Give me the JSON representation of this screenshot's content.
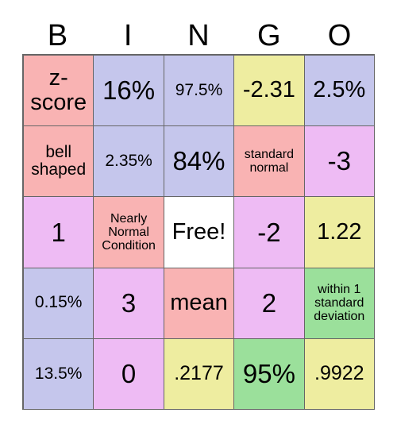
{
  "card": {
    "title": "BINGO",
    "headers": [
      "B",
      "I",
      "N",
      "G",
      "O"
    ],
    "colors": {
      "salmon": "#f9b3b3",
      "lavender": "#c5c6ec",
      "yellow": "#eeeda0",
      "violet": "#eebbf4",
      "green": "#9be09b",
      "white": "#ffffff",
      "grid_line": "#666666",
      "text": "#000000"
    },
    "rows": [
      [
        {
          "text": "z-score",
          "color": "#f9b3b3",
          "size": "fs-lg"
        },
        {
          "text": "16%",
          "color": "#c5c6ec",
          "size": "fs-xl"
        },
        {
          "text": "97.5%",
          "color": "#c5c6ec",
          "size": "fs-sm"
        },
        {
          "text": "-2.31",
          "color": "#eeeda0",
          "size": "fs-lg"
        },
        {
          "text": "2.5%",
          "color": "#c5c6ec",
          "size": "fs-lg"
        }
      ],
      [
        {
          "text": "bell shaped",
          "color": "#f9b3b3",
          "size": "fs-sm"
        },
        {
          "text": "2.35%",
          "color": "#c5c6ec",
          "size": "fs-sm"
        },
        {
          "text": "84%",
          "color": "#c5c6ec",
          "size": "fs-xl"
        },
        {
          "text": "standard normal",
          "color": "#f9b3b3",
          "size": "fs-xs"
        },
        {
          "text": "-3",
          "color": "#eebbf4",
          "size": "fs-xl"
        }
      ],
      [
        {
          "text": "1",
          "color": "#eebbf4",
          "size": "fs-xl"
        },
        {
          "text": "Nearly Normal Condition",
          "color": "#f9b3b3",
          "size": "fs-xs"
        },
        {
          "text": "Free!",
          "color": "#ffffff",
          "size": "fs-lg"
        },
        {
          "text": "-2",
          "color": "#eebbf4",
          "size": "fs-xl"
        },
        {
          "text": "1.22",
          "color": "#eeeda0",
          "size": "fs-lg"
        }
      ],
      [
        {
          "text": "0.15%",
          "color": "#c5c6ec",
          "size": "fs-sm"
        },
        {
          "text": "3",
          "color": "#eebbf4",
          "size": "fs-xl"
        },
        {
          "text": "mean",
          "color": "#f9b3b3",
          "size": "fs-lg"
        },
        {
          "text": "2",
          "color": "#eebbf4",
          "size": "fs-xl"
        },
        {
          "text": "within 1 standard deviation",
          "color": "#9be09b",
          "size": "fs-xs"
        }
      ],
      [
        {
          "text": "13.5%",
          "color": "#c5c6ec",
          "size": "fs-sm"
        },
        {
          "text": "0",
          "color": "#eebbf4",
          "size": "fs-xl"
        },
        {
          "text": ".2177",
          "color": "#eeeda0",
          "size": "fs-md"
        },
        {
          "text": "95%",
          "color": "#9be09b",
          "size": "fs-xl"
        },
        {
          "text": ".9922",
          "color": "#eeeda0",
          "size": "fs-md"
        }
      ]
    ]
  }
}
